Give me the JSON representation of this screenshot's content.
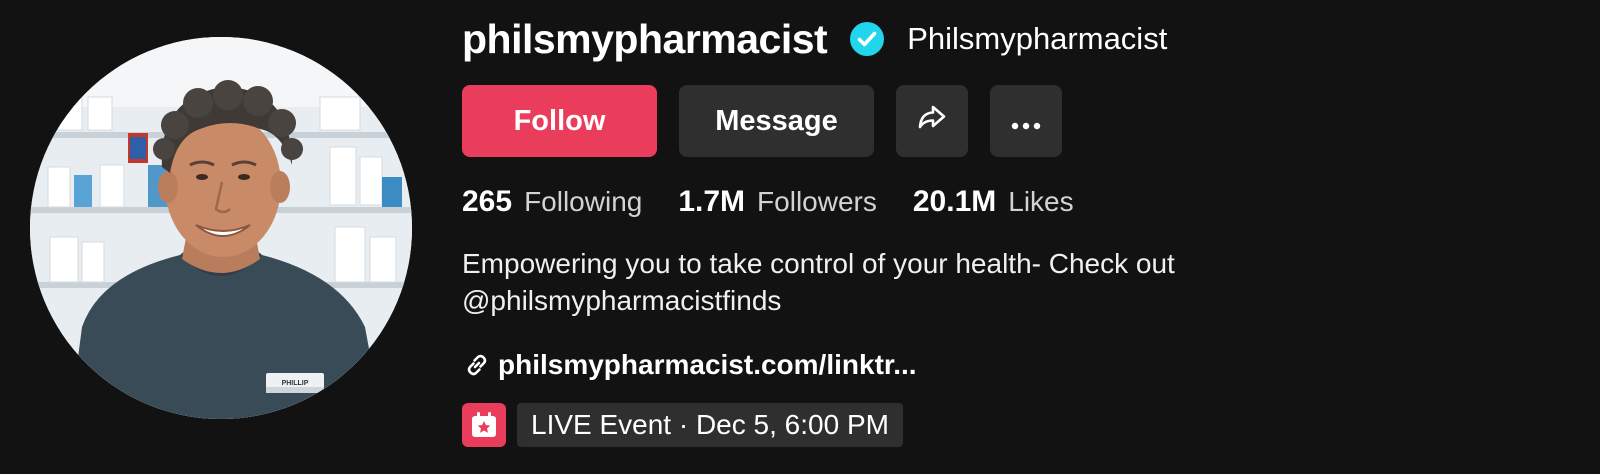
{
  "profile": {
    "username": "philsmypharmacist",
    "nickname": "Philsmypharmacist",
    "verified_icon": "verified-check-icon",
    "avatar_icon": "profile-photo",
    "name_tag": "PHILLIP"
  },
  "actions": {
    "follow_label": "Follow",
    "message_label": "Message",
    "share_icon": "share-arrow-icon",
    "more_icon": "more-dots-icon"
  },
  "stats": {
    "following": {
      "value": "265",
      "label": "Following"
    },
    "followers": {
      "value": "1.7M",
      "label": "Followers"
    },
    "likes": {
      "value": "20.1M",
      "label": "Likes"
    }
  },
  "bio": {
    "line1": "Empowering you to take control of your health- Check out",
    "line2": "@philsmypharmacistfinds"
  },
  "link": {
    "icon": "link-chain-icon",
    "text": "philsmypharmacist.com/linktr..."
  },
  "event": {
    "icon": "calendar-star-icon",
    "text": "LIVE Event · Dec 5, 6:00 PM"
  },
  "colors": {
    "background": "#121212",
    "accent": "#ea3d5b",
    "button_secondary": "#2f2f2f",
    "verified": "#20d5ec"
  }
}
